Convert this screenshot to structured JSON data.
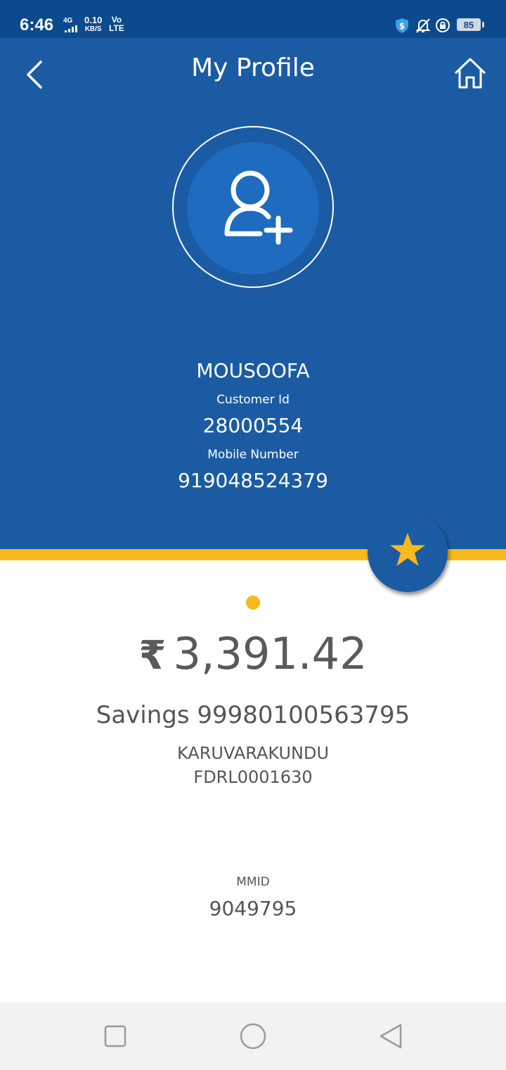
{
  "status_bar": {
    "time": "6:46",
    "network_type": "4G",
    "speed_value": "0.10",
    "speed_unit": "KB/S",
    "volte_top": "Vo",
    "volte_bottom": "LTE",
    "battery": "85",
    "icons": [
      "signal-icon",
      "shield-dollar-icon",
      "bell-muted-icon",
      "rotation-lock-icon",
      "battery-icon"
    ]
  },
  "header": {
    "title": "My Profile",
    "back_icon": "chevron-left-icon",
    "home_icon": "home-icon"
  },
  "profile": {
    "avatar_icon": "add-user-icon",
    "name": "MOUSOOFA",
    "customer_id_label": "Customer Id",
    "customer_id": "28000554",
    "mobile_label": "Mobile Number",
    "mobile_number": "919048524379"
  },
  "favorite_icon": "star-icon",
  "account": {
    "currency_symbol": "₹",
    "balance": "3,391.42",
    "account_line": "Savings 99980100563795",
    "branch": "KARUVARAKUNDU",
    "ifsc": "FDRL0001630",
    "mmid_label": "MMID",
    "mmid": "9049795"
  },
  "colors": {
    "primary_blue": "#1b5ba3",
    "status_blue": "#0b4a8c",
    "accent_yellow": "#f8b91c",
    "text_gray": "#555555"
  },
  "navigation": {
    "icons": [
      "recent-apps-icon",
      "home-circle-icon",
      "back-triangle-icon"
    ]
  }
}
